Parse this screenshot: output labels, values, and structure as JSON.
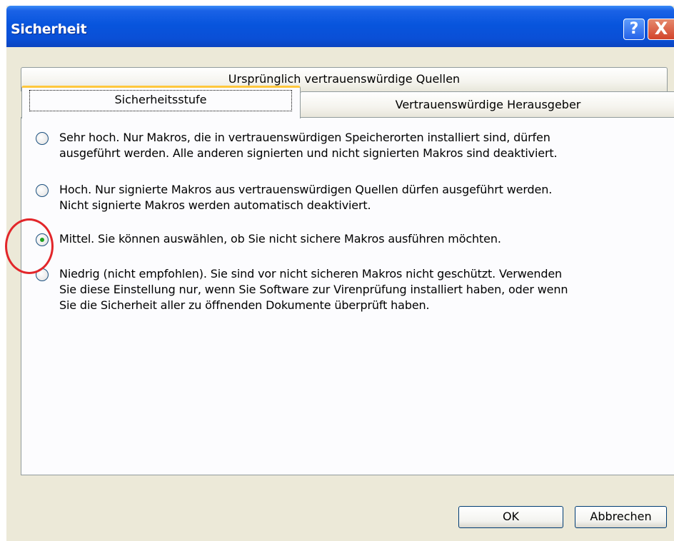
{
  "window": {
    "title": "Sicherheit",
    "help_label": "?",
    "close_label": "X"
  },
  "tabs": {
    "row1": [
      "Ursprünglich vertrauenswürdige Quellen"
    ],
    "active": "Sicherheitsstufe",
    "row2_other": "Vertrauenswürdige Herausgeber"
  },
  "options": [
    {
      "label": "Sehr hoch. Nur Makros, die in vertrauenswürdigen Speicherorten installiert sind, dürfen\nausgeführt werden. Alle anderen signierten und nicht signierten Makros sind deaktiviert.",
      "selected": false
    },
    {
      "label": "Hoch. Nur signierte Makros aus vertrauenswürdigen Quellen dürfen ausgeführt werden.\nNicht signierte Makros werden automatisch deaktiviert.",
      "selected": false
    },
    {
      "label": "Mittel. Sie können auswählen, ob Sie nicht sichere Makros ausführen möchten.",
      "selected": true
    },
    {
      "label": "Niedrig (nicht empfohlen). Sie sind vor nicht sicheren Makros nicht geschützt. Verwenden\nSie diese Einstellung nur, wenn Sie Software zur Virenprüfung installiert haben, oder wenn\nSie die Sicherheit aller zu öffnenden Dokumente überprüft haben.",
      "selected": false
    }
  ],
  "buttons": {
    "ok": "OK",
    "cancel": "Abbrechen"
  },
  "colors": {
    "titlebar": "#0855dd",
    "annotation_circle": "#e2262a",
    "active_tab_accent": "#ffc73c"
  }
}
